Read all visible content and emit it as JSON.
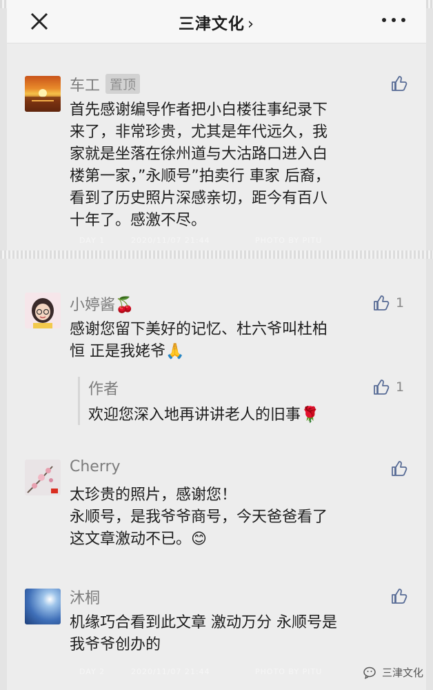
{
  "header": {
    "title": "三津文化",
    "chevron": "›"
  },
  "comments": [
    {
      "name": "车工",
      "badge": "置顶",
      "text_lines": [
        "首先感谢编导作者把小白楼往事纪录下",
        "来了，非常珍贵，尤其是年代远久，我",
        "家就是坐落在徐州道与大沽路口进入白",
        "楼第一家，”永顺号”拍卖行 車家 后裔，",
        "看到了历史照片深感亲切，距今有百八",
        "十年了。感激不尽。"
      ],
      "likes": ""
    },
    {
      "name": "小婷酱",
      "name_emoji": "🍒",
      "text_lines": [
        "感谢您留下美好的记忆、杜六爷叫杜柏",
        "恒 正是我姥爷🙏"
      ],
      "likes": "1",
      "reply": {
        "name": "作者",
        "text": "欢迎您深入地再讲讲老人的旧事🌹",
        "likes": "1"
      }
    },
    {
      "name": "Cherry",
      "text_lines": [
        "太珍贵的照片，感谢您！",
        "永顺号，是我爷爷商号，今天爸爸看了",
        "这文章激动不已。😊"
      ],
      "likes": ""
    },
    {
      "name": "沐桐",
      "text_lines": [
        "机缘巧合看到此文章 激动万分 永顺号是",
        "我爷爷创办的"
      ],
      "likes": ""
    }
  ],
  "photo_captions": {
    "top_left": "DAY 1",
    "top_mid": "2020/11/07 21:44",
    "top_right": "PHOTO BY PITU",
    "bottom_left": "DAY 2",
    "bottom_mid": "2020/11/07 21:44",
    "bottom_right": "PHOTO BY PITU"
  },
  "watermark": {
    "text": "三津文化"
  },
  "icons": {
    "close": "close-icon",
    "more": "more-icon",
    "like": "thumb-up-icon"
  },
  "colors": {
    "link": "#576b95",
    "name": "#7b7b7b"
  }
}
